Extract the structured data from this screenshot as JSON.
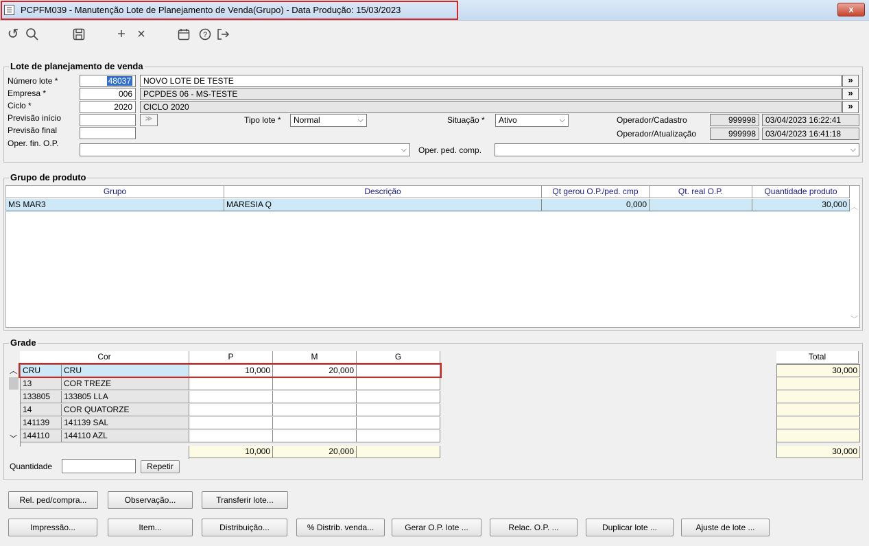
{
  "window": {
    "title": "PCPFM039 - Manutenção Lote de Planejamento de Venda(Grupo) - Data Produção: 15/03/2023",
    "close_label": "x"
  },
  "toolbar": {
    "icons": [
      "undo-icon",
      "search-icon",
      "save-icon",
      "add-icon",
      "delete-icon",
      "calendar-icon",
      "help-icon",
      "exit-icon"
    ]
  },
  "lote": {
    "section_title": "Lote de planejamento de venda",
    "numero_label": "Número lote *",
    "numero_value": "48037",
    "numero_desc": "NOVO LOTE DE TESTE",
    "empresa_label": "Empresa *",
    "empresa_value": "006",
    "empresa_desc": "PCPDES 06 - MS-TESTE",
    "ciclo_label": "Ciclo *",
    "ciclo_value": "2020",
    "ciclo_desc": "CICLO 2020",
    "prev_inicio_label": "Previsão início",
    "prev_final_label": "Previsão final",
    "tipo_label": "Tipo lote *",
    "tipo_value": "Normal",
    "situacao_label": "Situação *",
    "situacao_value": "Ativo",
    "op_cad_label": "Operador/Cadastro",
    "op_cad_value": "999998",
    "op_cad_date": "03/04/2023 16:22:41",
    "op_atu_label": "Operador/Atualização",
    "op_atu_value": "999998",
    "op_atu_date": "03/04/2023 16:41:18",
    "oper_fin_label": "Oper. fin. O.P.",
    "oper_ped_label": "Oper. ped. comp.",
    "more_btn": "»"
  },
  "grupo": {
    "section_title": "Grupo de produto",
    "headers": [
      "Grupo",
      "Descrição",
      "Qt gerou O.P./ped. cmp",
      "Qt. real O.P.",
      "Quantidade produto"
    ],
    "rows": [
      {
        "grupo": "MS MAR3",
        "descricao": "MARESIA Q",
        "qt_gerou": "0,000",
        "qt_real": "",
        "qtd_produto": "30,000"
      }
    ]
  },
  "grade": {
    "section_title": "Grade",
    "headers": {
      "cor": "Cor",
      "p": "P",
      "m": "M",
      "g": "G",
      "total": "Total"
    },
    "rows": [
      {
        "code": "CRU",
        "name": "CRU",
        "p": "10,000",
        "m": "20,000",
        "g": "",
        "total": "30,000"
      },
      {
        "code": "13",
        "name": "COR TREZE",
        "p": "",
        "m": "",
        "g": "",
        "total": ""
      },
      {
        "code": "133805",
        "name": "133805 LLA",
        "p": "",
        "m": "",
        "g": "",
        "total": ""
      },
      {
        "code": "14",
        "name": "COR QUATORZE",
        "p": "",
        "m": "",
        "g": "",
        "total": ""
      },
      {
        "code": "141139",
        "name": "141139 SAL",
        "p": "",
        "m": "",
        "g": "",
        "total": ""
      },
      {
        "code": "144110",
        "name": "144110 AZL",
        "p": "",
        "m": "",
        "g": "",
        "total": ""
      }
    ],
    "totals": {
      "p": "10,000",
      "m": "20,000",
      "g": "",
      "total": "30,000"
    },
    "quantidade_label": "Quantidade",
    "repetir_label": "Repetir"
  },
  "buttons": {
    "row1": [
      "Rel. ped/compra...",
      "Observação...",
      "Transferir lote..."
    ],
    "row2": [
      "Impressão...",
      "Item...",
      "Distribuição...",
      "% Distrib. venda...",
      "Gerar O.P. lote ...",
      "Relac. O.P. ...",
      "Duplicar lote ...",
      "Ajuste de lote ..."
    ]
  }
}
